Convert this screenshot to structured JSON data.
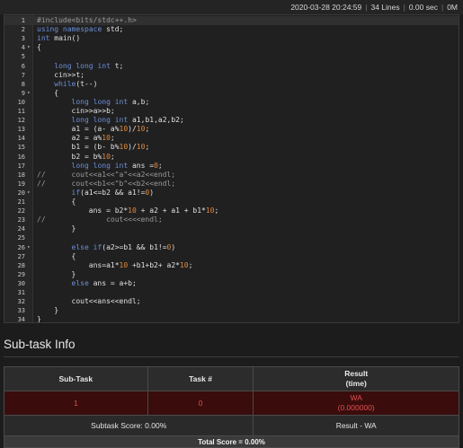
{
  "topbar": {
    "datetime": "2020-03-28 20:24:59",
    "lines": "34 Lines",
    "time": "0.00 sec",
    "memory": "0M"
  },
  "code_lines": [
    {
      "n": "1",
      "t": "#include<bits/stdc++.h>"
    },
    {
      "n": "2",
      "t": "using namespace std;"
    },
    {
      "n": "3",
      "t": "int main()"
    },
    {
      "n": "4",
      "t": "{",
      "fold": true
    },
    {
      "n": "5",
      "t": ""
    },
    {
      "n": "6",
      "t": "    long long int t;"
    },
    {
      "n": "7",
      "t": "    cin>>t;"
    },
    {
      "n": "8",
      "t": "    while(t--)"
    },
    {
      "n": "9",
      "t": "    {",
      "fold": true
    },
    {
      "n": "10",
      "t": "        long long int a,b;"
    },
    {
      "n": "11",
      "t": "        cin>>a>>b;"
    },
    {
      "n": "12",
      "t": "        long long int a1,b1,a2,b2;"
    },
    {
      "n": "13",
      "t": "        a1 = (a- a%10)/10;"
    },
    {
      "n": "14",
      "t": "        a2 = a%10;"
    },
    {
      "n": "15",
      "t": "        b1 = (b- b%10)/10;"
    },
    {
      "n": "16",
      "t": "        b2 = b%10;"
    },
    {
      "n": "17",
      "t": "        long long int ans =0;"
    },
    {
      "n": "18",
      "t": "//      cout<<a1<<\"a\"<<a2<<endl;"
    },
    {
      "n": "19",
      "t": "//      cout<<b1<<\"b\"<<b2<<endl;"
    },
    {
      "n": "20",
      "t": "        if(a1<=b2 && a1!=0)",
      "fold": true
    },
    {
      "n": "21",
      "t": "        {"
    },
    {
      "n": "22",
      "t": "            ans = b2*10 + a2 + a1 + b1*10;"
    },
    {
      "n": "23",
      "t": "//              cout<<<<endl;"
    },
    {
      "n": "24",
      "t": "        }"
    },
    {
      "n": "25",
      "t": ""
    },
    {
      "n": "26",
      "t": "        else if(a2>=b1 && b1!=0)",
      "fold": true
    },
    {
      "n": "27",
      "t": "        {"
    },
    {
      "n": "28",
      "t": "            ans=a1*10 +b1+b2+ a2*10;"
    },
    {
      "n": "29",
      "t": "        }"
    },
    {
      "n": "30",
      "t": "        else ans = a+b;"
    },
    {
      "n": "31",
      "t": ""
    },
    {
      "n": "32",
      "t": "        cout<<ans<<endl;"
    },
    {
      "n": "33",
      "t": "    }"
    },
    {
      "n": "34",
      "t": "}"
    }
  ],
  "subtask": {
    "heading": "Sub-task Info",
    "col_subtask": "Sub-Task",
    "col_task": "Task #",
    "col_result": "Result",
    "col_result_sub": "(time)",
    "row": {
      "subtask": "1",
      "task": "0",
      "verdict": "WA",
      "time": "(0.000000)"
    },
    "subtask_score": "Subtask Score: 0.00%",
    "result_label": "Result - WA",
    "total_score": "Total Score = 0.00%"
  },
  "colors": {
    "keyword": "#6b8fd9",
    "number": "#e08a3c",
    "comment": "#9a9a9a",
    "fail_row_bg": "#3a0c0c",
    "fail_text": "#e05050"
  }
}
